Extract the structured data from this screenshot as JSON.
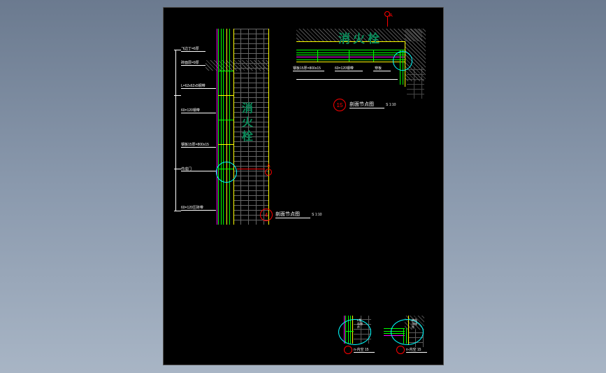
{
  "drawing": {
    "fire_hydrant_v": "消火栓",
    "fire_hydrant_h": "消火栓",
    "label_a": "A",
    "label_a2": "A",
    "anno1": "飞边丁=6厚",
    "anno2": "砖面层=9厚",
    "anno3": "L=62x62x5钢带",
    "anno4": "60=120钢带",
    "anno5": "钢板15厚=800x15",
    "anno6": "件成门",
    "anno7": "60=120压砖带",
    "anno8": "钢板15厚=800x15",
    "anno9": "60=120钢带",
    "anno10": "穿板",
    "title_left": "剖面节点图",
    "title_right": "剖面节点图",
    "scale_left": "S  1:10",
    "scale_right": "S  1:10",
    "marker4": "4",
    "marker15": "15",
    "mini_label1": "n-内空  15",
    "mini_label2": "n-内空  15"
  }
}
